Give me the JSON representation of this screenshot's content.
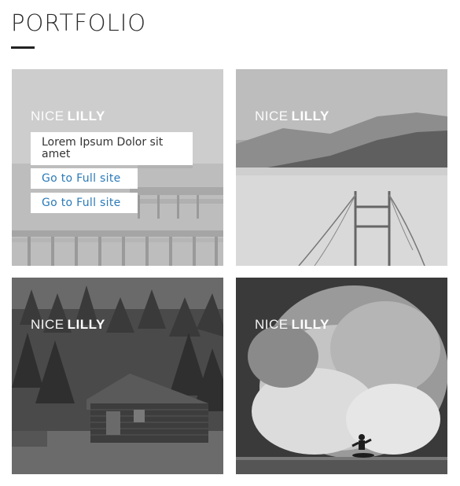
{
  "header": {
    "title": "PORTFOLIO"
  },
  "tiles": [
    {
      "brand_light": "NICE",
      "brand_bold": "LILLY",
      "caption": "Lorem Ipsum Dolor sit amet",
      "link_1": "Go to Full site",
      "link_2": "Go to Full site",
      "scene": "pier"
    },
    {
      "brand_light": "NICE",
      "brand_bold": "LILLY",
      "scene": "bridge"
    },
    {
      "brand_light": "NICE",
      "brand_bold": "LILLY",
      "scene": "cabin"
    },
    {
      "brand_light": "NICE",
      "brand_bold": "LILLY",
      "scene": "surf"
    }
  ],
  "colors": {
    "link": "#2a7ab8",
    "title": "#2b2b2b"
  }
}
